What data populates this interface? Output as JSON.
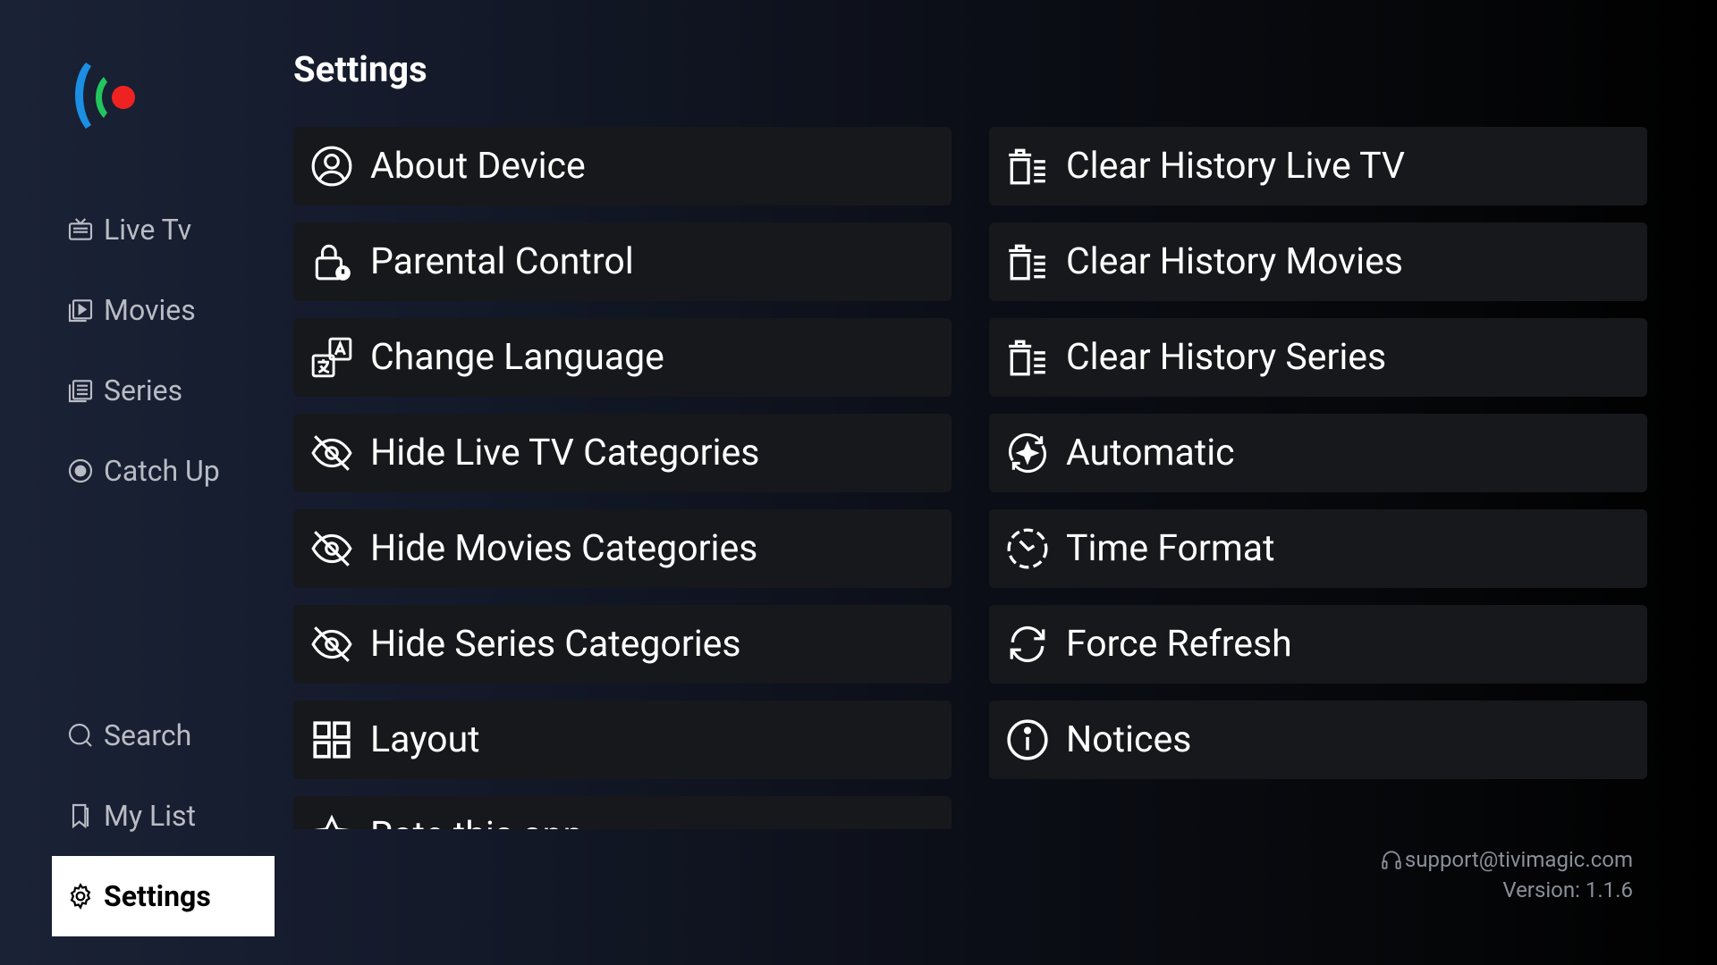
{
  "app": {
    "logo_colors": [
      "#1a8fe3",
      "#22c55e",
      "#ef2222"
    ]
  },
  "sidebar": {
    "items": [
      {
        "label": "Live Tv",
        "icon": "tv-icon"
      },
      {
        "label": "Movies",
        "icon": "play-box-icon"
      },
      {
        "label": "Series",
        "icon": "series-list-icon"
      },
      {
        "label": "Catch Up",
        "icon": "record-icon"
      },
      {
        "label": "Search",
        "icon": "search-icon"
      },
      {
        "label": "My List",
        "icon": "bookmark-icon"
      },
      {
        "label": "Settings",
        "icon": "gear-icon",
        "active": true
      }
    ]
  },
  "main": {
    "title": "Settings",
    "left_options": [
      {
        "label": "About Device",
        "icon": "user-circle-icon"
      },
      {
        "label": "Parental Control",
        "icon": "lock-icon"
      },
      {
        "label": "Change Language",
        "icon": "translate-icon"
      },
      {
        "label": "Hide Live TV Categories",
        "icon": "eye-off-icon"
      },
      {
        "label": "Hide Movies Categories",
        "icon": "eye-off-icon"
      },
      {
        "label": "Hide Series Categories",
        "icon": "eye-off-icon"
      },
      {
        "label": "Layout",
        "icon": "grid-icon"
      },
      {
        "label": "Rate this app",
        "icon": "star-icon"
      }
    ],
    "right_options": [
      {
        "label": "Clear History Live TV",
        "icon": "clear-history-icon"
      },
      {
        "label": "Clear History Movies",
        "icon": "clear-history-icon"
      },
      {
        "label": "Clear History Series",
        "icon": "clear-history-icon"
      },
      {
        "label": "Automatic",
        "icon": "auto-sparkle-icon"
      },
      {
        "label": "Time Format",
        "icon": "clock-dashed-icon"
      },
      {
        "label": "Force Refresh",
        "icon": "refresh-icon"
      },
      {
        "label": "Notices",
        "icon": "info-icon"
      }
    ]
  },
  "footer": {
    "support": "support@tivimagic.com",
    "version": "Version: 1.1.6"
  }
}
